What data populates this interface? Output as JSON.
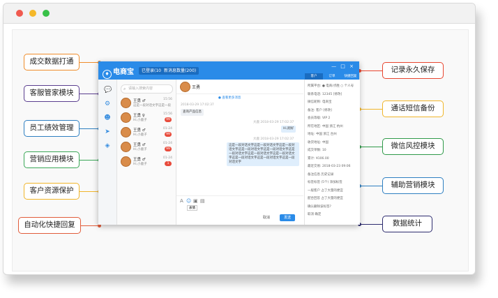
{
  "window_controls": {
    "close": "close",
    "minimize": "minimize",
    "maximize": "maximize"
  },
  "left_labels": [
    {
      "text": "成交数据打通",
      "color": "#ef8c2a"
    },
    {
      "text": "客服管家模块",
      "color": "#5b3e8f"
    },
    {
      "text": "员工绩效管理",
      "color": "#2e7fc1"
    },
    {
      "text": "营销应用模块",
      "color": "#3aa757"
    },
    {
      "text": "客户资源保护",
      "color": "#f0b52a"
    },
    {
      "text": "自动化快捷回复",
      "color": "#e15c3a"
    }
  ],
  "right_labels": [
    {
      "text": "记录永久保存",
      "color": "#e8452f"
    },
    {
      "text": "通话短信备份",
      "color": "#f0b52a"
    },
    {
      "text": "微信风控模块",
      "color": "#2f9a49"
    },
    {
      "text": "辅助营销模块",
      "color": "#2e7fc1"
    },
    {
      "text": "数据统计",
      "color": "#2c2b6e"
    }
  ],
  "app": {
    "logo": "电商宝",
    "logo_mark": "♦",
    "header_btn1": "已登录(100)",
    "header_btn2": "新消息数量(200)",
    "window_ctl": "— □ ×",
    "search_placeholder": "请输入搜索内容",
    "contacts": [
      {
        "name": "王勇 ♂",
        "msg": "这是一段对话文字这是一段",
        "time": "15:56",
        "badge": ""
      },
      {
        "name": "王勇 ♀",
        "msg": "Hi,小鹿子",
        "time": "15:56",
        "badge": "99"
      },
      {
        "name": "王勇 ♂",
        "msg": "Hi,小鹿子",
        "time": "01-24",
        "badge": "99"
      },
      {
        "name": "王勇 ♂",
        "msg": "Hi,小鹿子",
        "time": "01-24",
        "badge": "99"
      },
      {
        "name": "王勇 ♂",
        "msg": "Hi,小鹿子",
        "time": "01-24",
        "badge": "1"
      }
    ],
    "chat": {
      "contact_name": "王勇",
      "history_link": "● 查看更多消息",
      "messages": [
        {
          "time": "2018-03-29 17:02:37",
          "text": "查询产品信息"
        },
        {
          "time": "大鹿 2018-03-29 17:02:37",
          "text": "Hi,刚好"
        },
        {
          "time": "大鹿 2018-03-29 17:02:37",
          "text": "这是一段对话文字这是一段对话文字这是一段对话文字这是一段对话文字这是一段对话文字这是一段对话文字这是一段对话文字这是一段对话文字这是一段对话文字这是一段对话文字这是一段对话文字"
        }
      ],
      "input_tip": "表情",
      "cancel": "取消",
      "send": "发送"
    },
    "right": {
      "tabs": [
        "客户",
        "订单",
        "快捷回复"
      ],
      "rows": [
        "所属平台: ● 电商/点胜 ○ 个人号",
        "联系电话: 12345 [修改]",
        "微信昵称: 电商宝",
        "备注: 客户 [修改]",
        "会员等级: VIP 2",
        "所在地区: 中国 浙江 杭州",
        "地址: 中国 浙江 台州",
        "收货地址: 中国",
        "成交单数: 10",
        "累计: ¥106.00",
        "最近交易: 2018-03-23 09:06",
        "备注信息   历史记录",
        "标签标签 (5个)  添加标签",
        "一般客户   占了大量的便宜",
        "配合回答   占了大量的便宜",
        "确认删除该标签?",
        "取消   确定"
      ]
    }
  }
}
